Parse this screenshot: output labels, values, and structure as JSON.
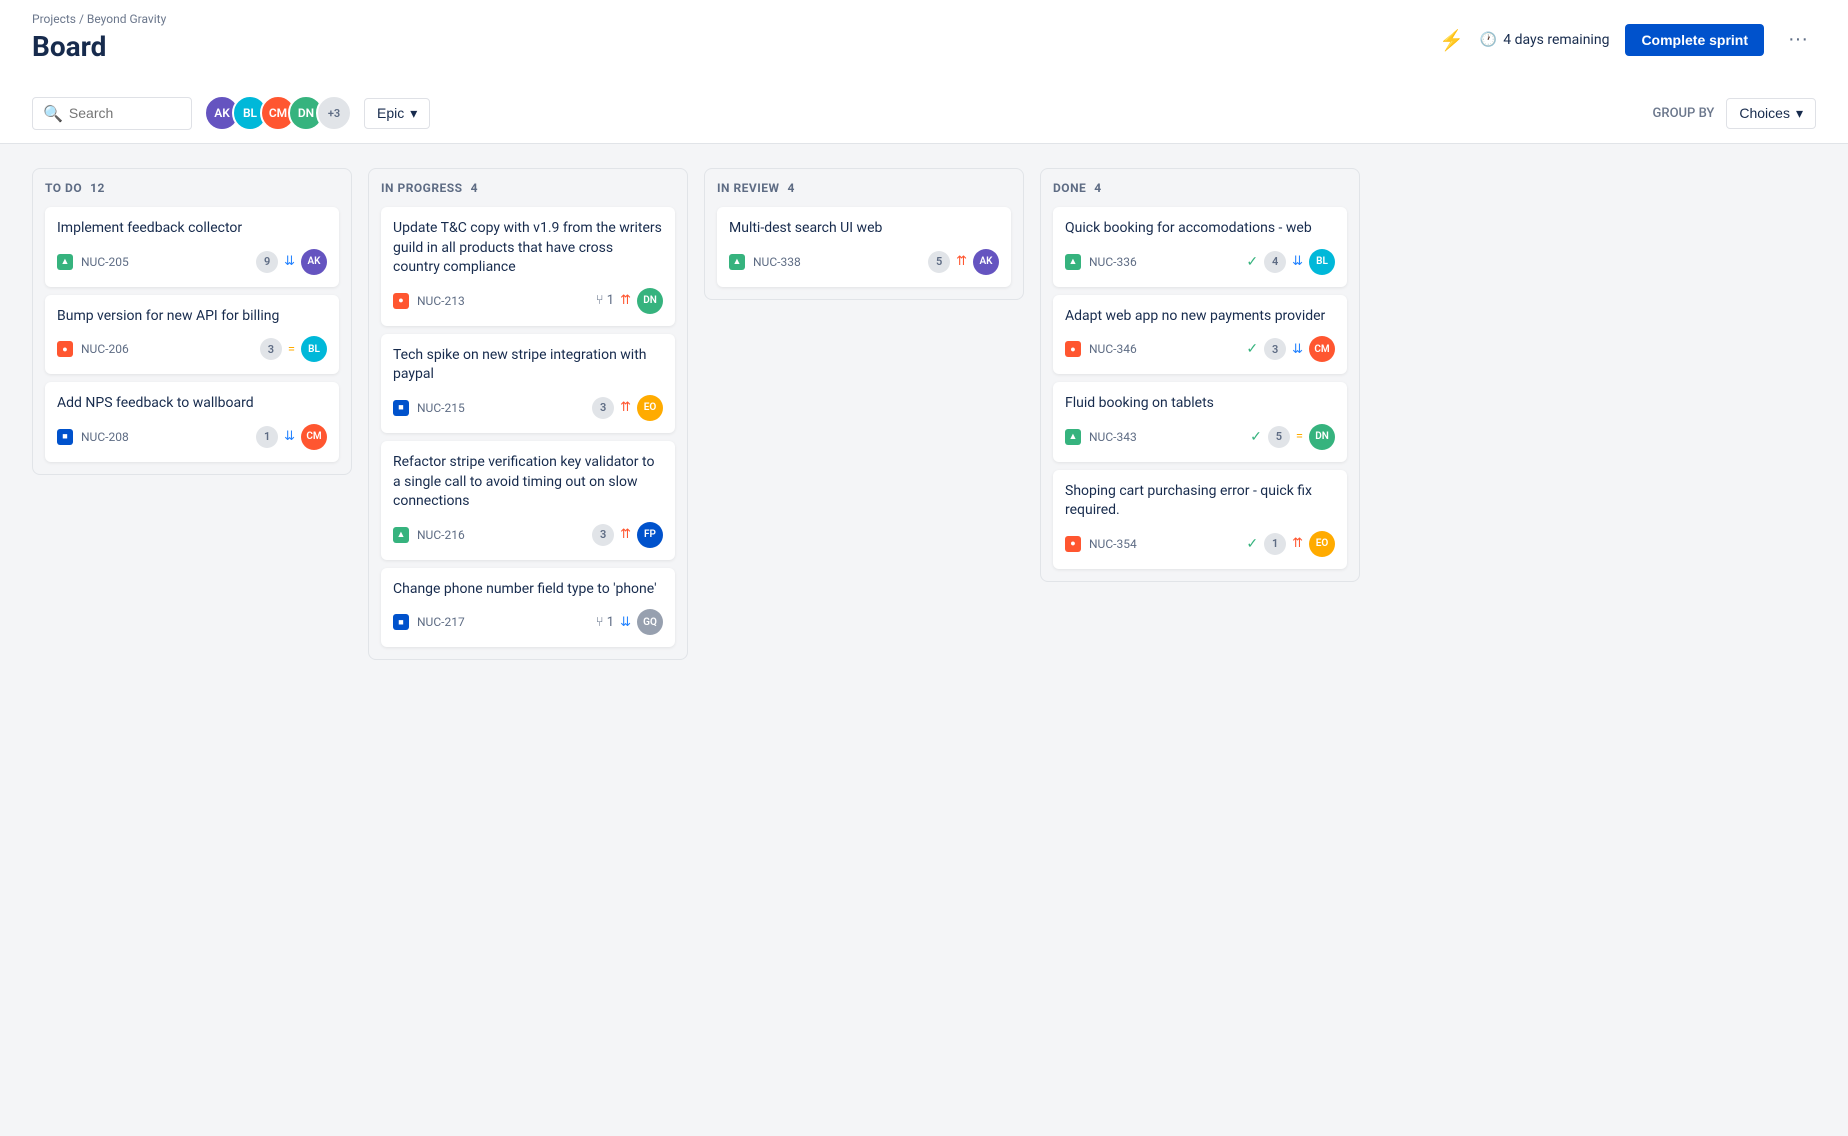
{
  "breadcrumb": "Projects / Beyond Gravity",
  "page_title": "Board",
  "sprint_info": {
    "days_remaining": "4 days remaining",
    "complete_btn": "Complete sprint",
    "more_btn": "···"
  },
  "toolbar": {
    "search_placeholder": "Search",
    "epic_label": "Epic",
    "group_by_label": "GROUP BY",
    "choices_label": "Choices"
  },
  "avatars_count": "+3",
  "columns": [
    {
      "id": "todo",
      "label": "TO DO",
      "count": 12,
      "cards": [
        {
          "title": "Implement feedback collector",
          "issue_type": "story",
          "issue_id": "NUC-205",
          "points": 9,
          "priority": "low",
          "priority_symbol": "▼"
        },
        {
          "title": "Bump version for new API for billing",
          "issue_type": "bug",
          "issue_id": "NUC-206",
          "points": 3,
          "priority": "medium",
          "priority_symbol": "="
        },
        {
          "title": "Add NPS feedback to wallboard",
          "issue_type": "task",
          "issue_id": "NUC-208",
          "points": 1,
          "priority": "low",
          "priority_symbol": "⇊"
        }
      ]
    },
    {
      "id": "inprogress",
      "label": "IN PROGRESS",
      "count": 4,
      "cards": [
        {
          "title": "Update T&C copy with v1.9 from the writers guild in all products that have cross country compliance",
          "issue_type": "bug",
          "issue_id": "NUC-213",
          "points": null,
          "branch": 1,
          "priority": "high",
          "priority_symbol": "⇈"
        },
        {
          "title": "Tech spike on new stripe integration with paypal",
          "issue_type": "task",
          "issue_id": "NUC-215",
          "points": 3,
          "priority": "high",
          "priority_symbol": "⇈"
        },
        {
          "title": "Refactor stripe verification key validator to a single call to avoid timing out on slow connections",
          "issue_type": "story",
          "issue_id": "NUC-216",
          "points": 3,
          "priority": "high",
          "priority_symbol": "⇈"
        },
        {
          "title": "Change phone number field type to 'phone'",
          "issue_type": "task",
          "issue_id": "NUC-217",
          "branch": 1,
          "points": null,
          "priority": "low",
          "priority_symbol": "⇊"
        }
      ]
    },
    {
      "id": "inreview",
      "label": "IN REVIEW",
      "count": 4,
      "cards": [
        {
          "title": "Multi-dest search UI web",
          "issue_type": "story",
          "issue_id": "NUC-338",
          "points": 5,
          "priority": "high",
          "priority_symbol": "^"
        }
      ]
    },
    {
      "id": "done",
      "label": "DONE",
      "count": 4,
      "cards": [
        {
          "title": "Quick booking for accomodations - web",
          "issue_type": "story",
          "issue_id": "NUC-336",
          "points": 4,
          "has_check": true,
          "priority": "low",
          "priority_symbol": "⇊"
        },
        {
          "title": "Adapt web app no new payments provider",
          "issue_type": "bug",
          "issue_id": "NUC-346",
          "points": 3,
          "has_check": true,
          "priority": "low",
          "priority_symbol": "▼"
        },
        {
          "title": "Fluid booking on tablets",
          "issue_type": "story",
          "issue_id": "NUC-343",
          "points": 5,
          "has_check": true,
          "priority": "medium",
          "priority_symbol": "="
        },
        {
          "title": "Shoping cart purchasing error - quick fix required.",
          "issue_type": "bug",
          "issue_id": "NUC-354",
          "points": 1,
          "has_check": true,
          "priority": "high",
          "priority_symbol": "⇈"
        }
      ]
    }
  ]
}
